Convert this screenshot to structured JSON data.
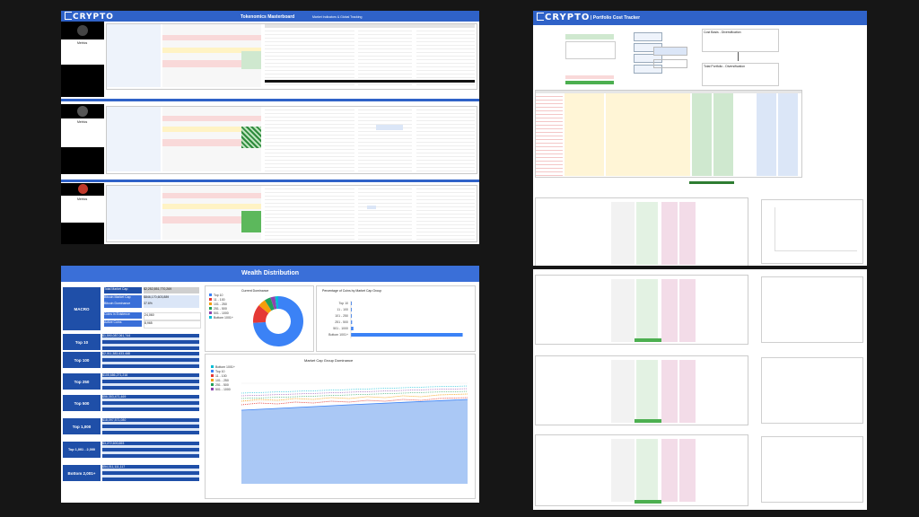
{
  "panels": {
    "masterboard": {
      "logo_text": "CRYPTO",
      "title": "Tokenomics Masterboard",
      "subtitle": "Market Indicators & Global Tracking",
      "section_labels": [
        "Metrics",
        "Metrics",
        "Metrics"
      ]
    },
    "cost_tracker": {
      "logo_text": "CRYPTO",
      "title": "| Portfolio Cost Tracker",
      "box1": "Cost Basis - Diversification",
      "box2": "Total Portfolio - Diversification"
    },
    "wealth": {
      "title": "Wealth Distribution",
      "macro_label": "MACRO",
      "macro_rows": [
        {
          "label": "Total Market Cap",
          "value": "$2,252,851,770,269"
        },
        {
          "label": "Bitcoin Market Cap",
          "value": "$846,170,603,889"
        },
        {
          "label": "Bitcoin Dominance",
          "value": "37.6%"
        },
        {
          "label": "Coins in Existence",
          "value": "24,060"
        },
        {
          "label": "Active Coins",
          "value": "8,965"
        }
      ],
      "groups": [
        {
          "label": "Top 10",
          "value": "$1,590,087,061,744"
        },
        {
          "label": "Top 100",
          "value": "$2,011,383,633,468"
        },
        {
          "label": "Top 250",
          "value": "$105,686,271,216"
        },
        {
          "label": "Top 500",
          "value": "$56,353,471,469"
        },
        {
          "label": "Top 1,000",
          "value": "$18,097,571,080"
        },
        {
          "label": "Top 1,001 - 2,000",
          "value": "$3,272,600,693"
        },
        {
          "label": "Bottom 2,001+",
          "value": "$54,011,111,117"
        }
      ],
      "pie": {
        "title": "Current Dominance",
        "legend": [
          "Top 10",
          "11 - 100",
          "101 - 250",
          "251 - 500",
          "501 - 1000",
          "Bottom 1001+"
        ],
        "colors": [
          "#3b82f6",
          "#e53935",
          "#f59e0b",
          "#22a05a",
          "#8e44ad",
          "#00bcd4"
        ],
        "values": [
          74,
          12,
          5,
          4,
          3,
          2
        ]
      },
      "bar": {
        "title": "Percentage of Coins by Market Cap Group",
        "categories": [
          "Top 10",
          "11 - 100",
          "101 - 250",
          "251 - 500",
          "501 - 1000",
          "Bottom 1001+"
        ],
        "values": [
          0.04,
          0.4,
          0.6,
          1.0,
          2.1,
          95.8
        ],
        "color": "#3b82f6"
      },
      "area": {
        "title": "Market Cap Group Dominance",
        "legend": [
          "Bottom 1001+",
          "Top 10",
          "11 - 100",
          "101 - 250",
          "251 - 500",
          "501 - 1000"
        ]
      }
    }
  },
  "chart_data": [
    {
      "type": "pie",
      "title": "Current Dominance",
      "categories": [
        "Top 10",
        "11 - 100",
        "101 - 250",
        "251 - 500",
        "501 - 1000",
        "Bottom 1001+"
      ],
      "values": [
        74,
        12,
        5,
        4,
        3,
        2
      ]
    },
    {
      "type": "bar",
      "title": "Percentage of Coins by Market Cap Group",
      "categories": [
        "Top 10",
        "11 - 100",
        "101 - 250",
        "251 - 500",
        "501 - 1000",
        "Bottom 1001+"
      ],
      "values": [
        0.04,
        0.4,
        0.6,
        1.0,
        2.1,
        95.8
      ]
    }
  ]
}
